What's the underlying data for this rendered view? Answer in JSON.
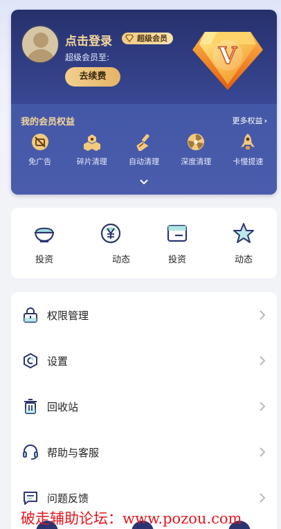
{
  "member_card": {
    "login_title": "点击登录",
    "vip_badge": "超级会员",
    "expire_label": "超级会员至:",
    "renew_button": "去续费",
    "gem_letter": "V"
  },
  "rights": {
    "title": "我的会员权益",
    "more": "更多权益",
    "items": [
      {
        "label": "免广告",
        "icon": "no-ads-icon"
      },
      {
        "label": "碎片清理",
        "icon": "fragment-clean-icon"
      },
      {
        "label": "自动清理",
        "icon": "auto-clean-icon"
      },
      {
        "label": "深度清理",
        "icon": "deep-clean-icon"
      },
      {
        "label": "卡慢提速",
        "icon": "rocket-icon"
      }
    ]
  },
  "quick_actions": [
    {
      "label": "投资",
      "icon": "bowl-icon"
    },
    {
      "label": "动态",
      "icon": "yen-coin-icon"
    },
    {
      "label": "投资",
      "icon": "card-icon"
    },
    {
      "label": "动态",
      "icon": "star-icon"
    }
  ],
  "menu": [
    {
      "label": "权限管理",
      "icon": "lock-icon"
    },
    {
      "label": "设置",
      "icon": "settings-icon"
    },
    {
      "label": "回收站",
      "icon": "trash-icon"
    },
    {
      "label": "帮助与客服",
      "icon": "headset-icon"
    },
    {
      "label": "问题反馈",
      "icon": "feedback-icon"
    }
  ],
  "watermark": "破走辅助论坛：www.pozou.com",
  "colors": {
    "card_dark": "#26306c",
    "card_light": "#4254a5",
    "gold": "#f4d699",
    "icon_navy": "#2b3470",
    "watermark_red": "#e4161c"
  }
}
